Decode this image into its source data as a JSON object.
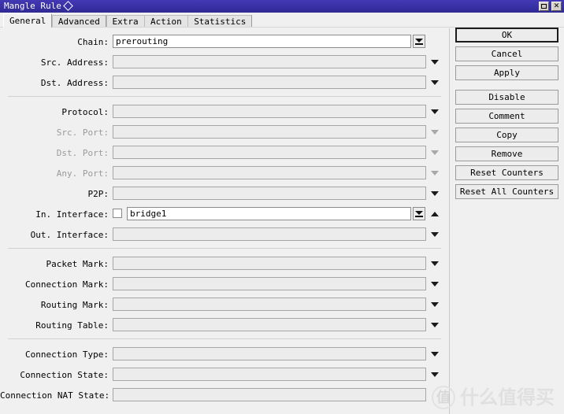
{
  "window": {
    "title": "Mangle Rule",
    "title_icon": "diamond-icon",
    "titlebar_color": "#3730a3",
    "buttons": [
      {
        "name": "maximize",
        "icon": "maximize-icon"
      },
      {
        "name": "close",
        "icon": "close-icon",
        "glyph": "✕"
      }
    ]
  },
  "tabs": [
    {
      "label": "General",
      "active": true
    },
    {
      "label": "Advanced",
      "active": false
    },
    {
      "label": "Extra",
      "active": false
    },
    {
      "label": "Action",
      "active": false
    },
    {
      "label": "Statistics",
      "active": false
    }
  ],
  "form": {
    "groups": [
      {
        "fields": [
          {
            "label": "Chain:",
            "value": "prerouting",
            "enabled": true,
            "active": true,
            "control": "combo-boxed"
          },
          {
            "label": "Src. Address:",
            "value": "",
            "enabled": true,
            "active": false,
            "control": "arrow"
          },
          {
            "label": "Dst. Address:",
            "value": "",
            "enabled": true,
            "active": false,
            "control": "arrow"
          }
        ]
      },
      {
        "fields": [
          {
            "label": "Protocol:",
            "value": "",
            "enabled": true,
            "active": false,
            "control": "arrow"
          },
          {
            "label": "Src. Port:",
            "value": "",
            "enabled": false,
            "active": false,
            "control": "arrow"
          },
          {
            "label": "Dst. Port:",
            "value": "",
            "enabled": false,
            "active": false,
            "control": "arrow"
          },
          {
            "label": "Any. Port:",
            "value": "",
            "enabled": false,
            "active": false,
            "control": "arrow"
          },
          {
            "label": "P2P:",
            "value": "",
            "enabled": true,
            "active": false,
            "control": "arrow"
          },
          {
            "label": "In. Interface:",
            "value": "bridge1",
            "enabled": true,
            "active": true,
            "control": "combo-boxed",
            "checkbox": true,
            "checked": false,
            "extra_arrow": "up"
          },
          {
            "label": "Out. Interface:",
            "value": "",
            "enabled": true,
            "active": false,
            "control": "arrow"
          }
        ]
      },
      {
        "fields": [
          {
            "label": "Packet Mark:",
            "value": "",
            "enabled": true,
            "active": false,
            "control": "arrow"
          },
          {
            "label": "Connection Mark:",
            "value": "",
            "enabled": true,
            "active": false,
            "control": "arrow"
          },
          {
            "label": "Routing Mark:",
            "value": "",
            "enabled": true,
            "active": false,
            "control": "arrow"
          },
          {
            "label": "Routing Table:",
            "value": "",
            "enabled": true,
            "active": false,
            "control": "arrow"
          }
        ]
      },
      {
        "fields": [
          {
            "label": "Connection Type:",
            "value": "",
            "enabled": true,
            "active": false,
            "control": "arrow"
          },
          {
            "label": "Connection State:",
            "value": "",
            "enabled": true,
            "active": false,
            "control": "arrow"
          },
          {
            "label": "Connection NAT State:",
            "value": "",
            "enabled": true,
            "active": false,
            "control": "none"
          }
        ]
      }
    ]
  },
  "actions": [
    {
      "label": "OK",
      "default": true,
      "gap_before": false
    },
    {
      "label": "Cancel",
      "default": false,
      "gap_before": false
    },
    {
      "label": "Apply",
      "default": false,
      "gap_before": false
    },
    {
      "label": "Disable",
      "default": false,
      "gap_before": true
    },
    {
      "label": "Comment",
      "default": false,
      "gap_before": false
    },
    {
      "label": "Copy",
      "default": false,
      "gap_before": false
    },
    {
      "label": "Remove",
      "default": false,
      "gap_before": false
    },
    {
      "label": "Reset Counters",
      "default": false,
      "gap_before": false
    },
    {
      "label": "Reset All Counters",
      "default": false,
      "gap_before": false
    }
  ],
  "watermark": {
    "logo_char": "值",
    "text": "什么值得买"
  }
}
